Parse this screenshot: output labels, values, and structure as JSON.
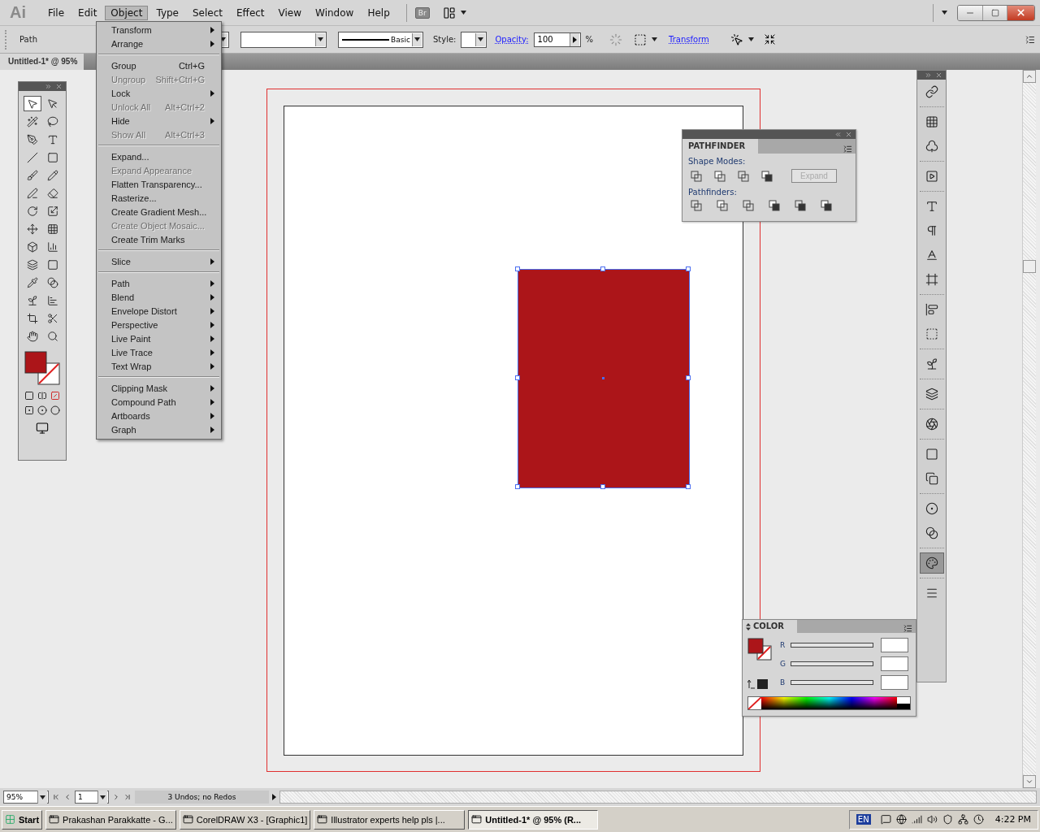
{
  "app": {
    "logo": "Ai"
  },
  "menu": [
    {
      "label": "File",
      "selected": false
    },
    {
      "label": "Edit",
      "selected": false
    },
    {
      "label": "Object",
      "selected": true
    },
    {
      "label": "Type",
      "selected": false
    },
    {
      "label": "Select",
      "selected": false
    },
    {
      "label": "Effect",
      "selected": false
    },
    {
      "label": "View",
      "selected": false
    },
    {
      "label": "Window",
      "selected": false
    },
    {
      "label": "Help",
      "selected": false
    }
  ],
  "bridge_button": "Br",
  "control_bar": {
    "selection": "Path",
    "stroke_profile": "Basic",
    "style_label": "Style:",
    "opacity_label": "Opacity:",
    "opacity": "100",
    "percent": "%",
    "transform_link": "Transform"
  },
  "document_tab": {
    "title": "Untitled-1* @ 95%"
  },
  "object_menu": [
    [
      {
        "label": "Transform",
        "submenu": true,
        "disabled": false
      },
      {
        "label": "Arrange",
        "submenu": true,
        "disabled": false
      }
    ],
    [
      {
        "label": "Group",
        "shortcut": "Ctrl+G",
        "submenu": false,
        "disabled": false
      },
      {
        "label": "Ungroup",
        "shortcut": "Shift+Ctrl+G",
        "submenu": false,
        "disabled": true
      },
      {
        "label": "Lock",
        "submenu": true,
        "disabled": false
      },
      {
        "label": "Unlock All",
        "shortcut": "Alt+Ctrl+2",
        "submenu": false,
        "disabled": true
      },
      {
        "label": "Hide",
        "submenu": true,
        "disabled": false
      },
      {
        "label": "Show All",
        "shortcut": "Alt+Ctrl+3",
        "submenu": false,
        "disabled": true
      }
    ],
    [
      {
        "label": "Expand...",
        "submenu": false,
        "disabled": false
      },
      {
        "label": "Expand Appearance",
        "submenu": false,
        "disabled": true
      },
      {
        "label": "Flatten Transparency...",
        "submenu": false,
        "disabled": false
      },
      {
        "label": "Rasterize...",
        "submenu": false,
        "disabled": false
      },
      {
        "label": "Create Gradient Mesh...",
        "submenu": false,
        "disabled": false
      },
      {
        "label": "Create Object Mosaic...",
        "submenu": false,
        "disabled": true
      },
      {
        "label": "Create Trim Marks",
        "submenu": false,
        "disabled": false
      }
    ],
    [
      {
        "label": "Slice",
        "submenu": true,
        "disabled": false
      }
    ],
    [
      {
        "label": "Path",
        "submenu": true,
        "disabled": false
      },
      {
        "label": "Blend",
        "submenu": true,
        "disabled": false
      },
      {
        "label": "Envelope Distort",
        "submenu": true,
        "disabled": false
      },
      {
        "label": "Perspective",
        "submenu": true,
        "disabled": false
      },
      {
        "label": "Live Paint",
        "submenu": true,
        "disabled": false
      },
      {
        "label": "Live Trace",
        "submenu": true,
        "disabled": false
      },
      {
        "label": "Text Wrap",
        "submenu": true,
        "disabled": false
      }
    ],
    [
      {
        "label": "Clipping Mask",
        "submenu": true,
        "disabled": false
      },
      {
        "label": "Compound Path",
        "submenu": true,
        "disabled": false
      },
      {
        "label": "Artboards",
        "submenu": true,
        "disabled": false
      },
      {
        "label": "Graph",
        "submenu": true,
        "disabled": false
      }
    ]
  ],
  "pathfinder": {
    "title": "PATHFINDER",
    "shape_modes_label": "Shape Modes:",
    "expand_button": {
      "label": "Expand",
      "disabled": true
    },
    "pathfinders_label": "Pathfinders:"
  },
  "color_panel": {
    "title": "COLOR",
    "channels": [
      {
        "label": "R"
      },
      {
        "label": "G"
      },
      {
        "label": "B"
      }
    ]
  },
  "status_bar": {
    "zoom": "95%",
    "artboard": "1",
    "status": "3 Undos; no Redos"
  },
  "taskbar": {
    "start": "Start",
    "tasks": [
      {
        "label": "Prakashan Parakkatte - G...",
        "selected": false
      },
      {
        "label": "CorelDRAW X3 - [Graphic1]",
        "selected": false
      },
      {
        "label": "Illustrator experts help pls |...",
        "selected": false
      },
      {
        "label": "Untitled-1* @ 95% (R...",
        "selected": true
      }
    ],
    "language": "EN",
    "clock": "4:22 PM"
  }
}
